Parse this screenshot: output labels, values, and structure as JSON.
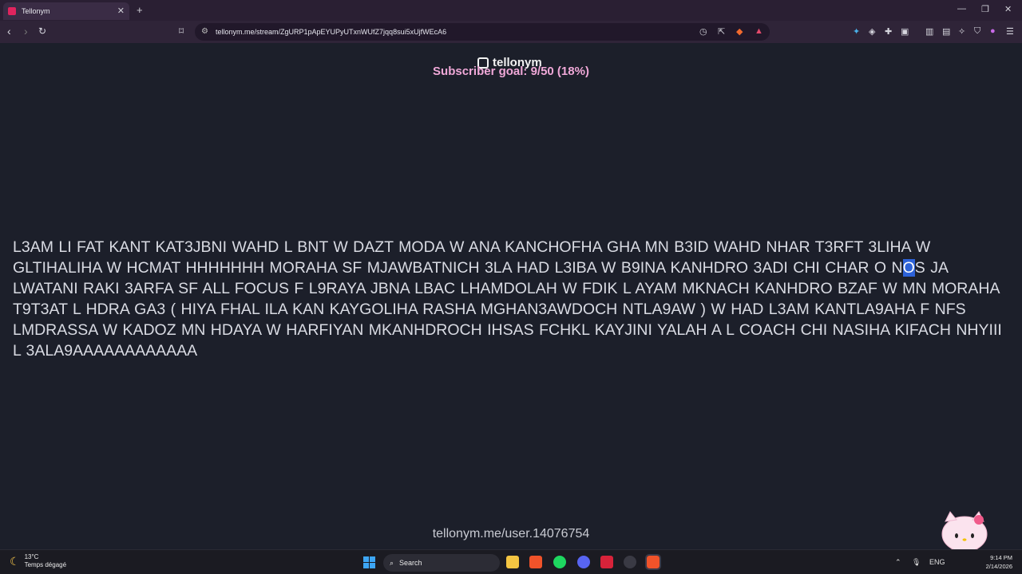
{
  "browser": {
    "tab_title": "Tellonym",
    "url": "tellonym.me/stream/ZgURP1pApEYUPyUTxnWUfZ7jqq8sui5xUjfWEcA6"
  },
  "page": {
    "logo_text": "tellonym",
    "subscriber_goal": "Subscriber goal: 9/50 (18%)",
    "message_before": "L3AM LI FAT KANT KAT3JBNI WAHD L BNT W DAZT MODA W ANA KANCHOFHA GHA MN B3ID WAHD NHAR T3RFT 3LIHA W GLTIHALIHA W HCMAT HHHHHHH MORAHA SF MJAWBATNICH 3LA HAD L3IBA W B9INA KANHDRO 3ADI CHI CHAR O N",
    "message_selected": "O",
    "message_after": "S JA LWATANI RAKI 3ARFA SF ALL FOCUS F L9RAYA JBNA LBAC LHAMDOLAH W FDIK L AYAM MKNACH KANHDRO BZAF W MN MORAHA T9T3AT L HDRA GA3 ( HIYA FHAL ILA KAN KAYGOLIHA RASHA MGHAN3AWDOCH NTLA9AW ) W HAD L3AM KANTLA9AHA F NFS LMDRASSA W KADOZ MN HDAYA W HARFIYAN MKANHDROCH IHSAS FCHKL KAYJINI YALAH A L COACH CHI NASIHA KIFACH NHYIII L 3ALA9AAAAAAAAAAAA",
    "footer_link": "tellonym.me/user.14076754"
  },
  "taskbar": {
    "temperature": "13°C",
    "weather_desc": "Temps dégagé",
    "search_label": "Search",
    "language": "ENG",
    "time": "9:14 PM",
    "date": "2/14/2026"
  }
}
